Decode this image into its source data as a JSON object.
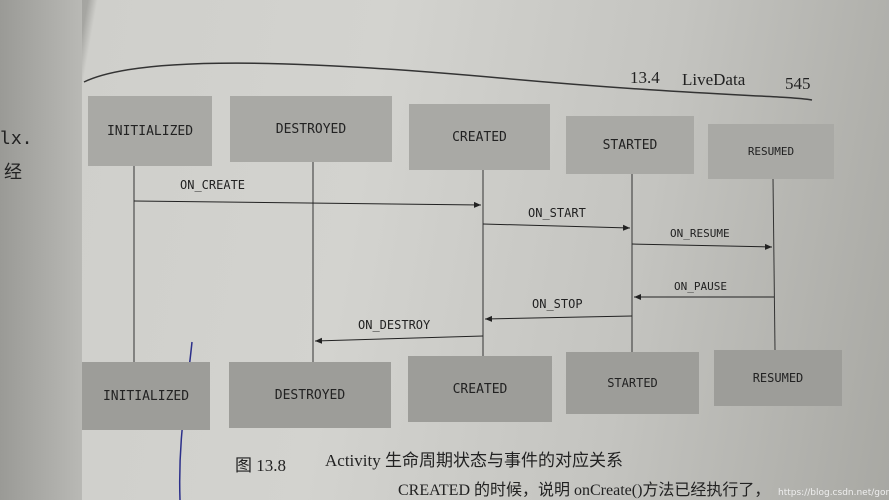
{
  "header": {
    "section": "13.4",
    "title": "LiveData",
    "page": "545"
  },
  "left_margin": {
    "fragments": [
      "lx.",
      "经"
    ]
  },
  "states_top": [
    "INITIALIZED",
    "DESTROYED",
    "CREATED",
    "STARTED",
    "RESUMED"
  ],
  "states_bottom": [
    "INITIALIZED",
    "DESTROYED",
    "CREATED",
    "STARTED",
    "RESUMED"
  ],
  "events": [
    {
      "label": "ON_CREATE",
      "from": "INITIALIZED",
      "to": "CREATED"
    },
    {
      "label": "ON_START",
      "from": "CREATED",
      "to": "STARTED"
    },
    {
      "label": "ON_RESUME",
      "from": "STARTED",
      "to": "RESUMED"
    },
    {
      "label": "ON_PAUSE",
      "from": "RESUMED",
      "to": "STARTED"
    },
    {
      "label": "ON_STOP",
      "from": "STARTED",
      "to": "CREATED"
    },
    {
      "label": "ON_DESTROY",
      "from": "CREATED",
      "to": "DESTROYED"
    }
  ],
  "caption": {
    "number": "图 13.8",
    "text": "Activity 生命周期状态与事件的对应关系"
  },
  "body_text": "CREATED 的时候，说明 onCreate()方法已经执行了，",
  "watermark": "https://blog.csdn.net/gongjdde"
}
